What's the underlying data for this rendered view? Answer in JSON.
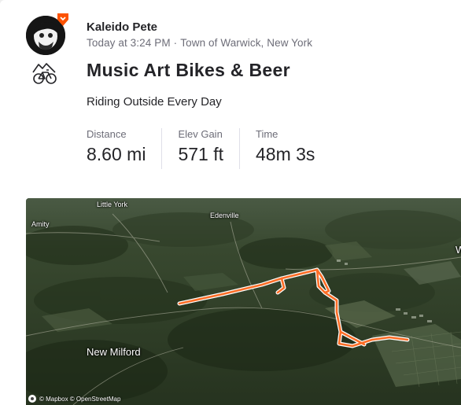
{
  "athlete": {
    "name": "Kaleido Pete",
    "timestamp": "Today at 3:24 PM",
    "separator": "·",
    "location": "Town of Warwick, New York",
    "badge_color": "#fc5200"
  },
  "activity": {
    "sport_icon": "ride-icon",
    "title": "Music Art Bikes & Beer",
    "description": "Riding Outside Every Day",
    "stats": [
      {
        "label": "Distance",
        "value": "8.60 mi"
      },
      {
        "label": "Elev Gain",
        "value": "571 ft"
      },
      {
        "label": "Time",
        "value": "48m 3s"
      }
    ]
  },
  "map": {
    "labels": {
      "little_york": "Little York",
      "edenville": "Edenville",
      "amity": "Amity",
      "new_milford": "New Milford",
      "edge": "W"
    },
    "attribution": "© Mapbox © OpenStreetMap",
    "route_color": "#fc6d26"
  }
}
